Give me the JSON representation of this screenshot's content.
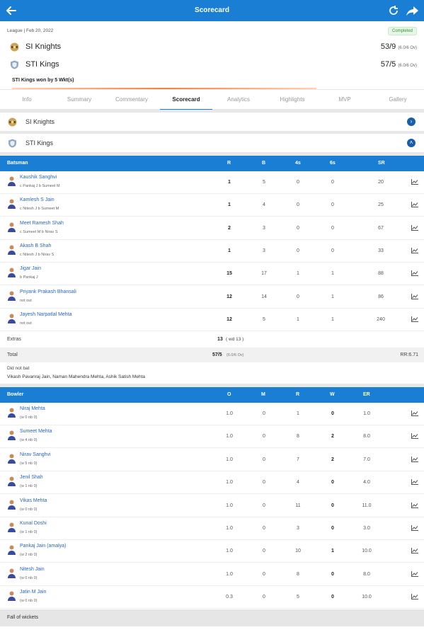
{
  "header": {
    "title": "Scorecard",
    "back_icon": "back-arrow-icon",
    "refresh_icon": "refresh-icon",
    "share_icon": "share-icon",
    "bg_color": "#1a7fd4"
  },
  "match": {
    "meta": "League | Feb 20, 2022",
    "status": "Completed",
    "team1": {
      "name": "SI Knights",
      "score": "53/9",
      "overs": "(6.0/6 Ov)"
    },
    "team2": {
      "name": "STI Kings",
      "score": "57/5",
      "overs": "(6.0/6 Ov)"
    },
    "result": "STI Kings won by 5 Wkt(s)"
  },
  "tabs": [
    "Info",
    "Summary",
    "Commentary",
    "Scorecard",
    "Analytics",
    "Highlights",
    "MVP",
    "Gallery"
  ],
  "active_tab": "Scorecard",
  "innings": [
    {
      "name": "SI Knights",
      "state": "collapsed"
    },
    {
      "name": "STI Kings",
      "state": "expanded"
    }
  ],
  "batting": {
    "headers": {
      "batsman": "Batsman",
      "r": "R",
      "b": "B",
      "fours": "4s",
      "sixes": "6s",
      "sr": "SR"
    },
    "rows": [
      {
        "name": "Kaushik Sanghvi",
        "desc": "c Pankaj J b Sumeet M",
        "r": "1",
        "b": "5",
        "fours": "0",
        "sixes": "0",
        "sr": "20"
      },
      {
        "name": "Kamlesh S Jain",
        "desc": "c Nitesh J b Sumeet M",
        "r": "1",
        "b": "4",
        "fours": "0",
        "sixes": "0",
        "sr": "25"
      },
      {
        "name": "Meet Ramesh Shah",
        "desc": "c Sumeet M b Nirav S",
        "r": "2",
        "b": "3",
        "fours": "0",
        "sixes": "0",
        "sr": "67"
      },
      {
        "name": "Akash B Shah",
        "desc": "c Nitesh J b Nirav S",
        "r": "1",
        "b": "3",
        "fours": "0",
        "sixes": "0",
        "sr": "33"
      },
      {
        "name": "Jigar Jain",
        "desc": "b Pankaj J",
        "r": "15",
        "b": "17",
        "fours": "1",
        "sixes": "1",
        "sr": "88"
      },
      {
        "name": "Priyank Prakash Bhansali",
        "desc": "not out",
        "r": "12",
        "b": "14",
        "fours": "0",
        "sixes": "1",
        "sr": "86"
      },
      {
        "name": "Jayesh Narpatlal Mehta",
        "desc": "not out",
        "r": "12",
        "b": "5",
        "fours": "1",
        "sixes": "1",
        "sr": "240"
      }
    ],
    "extras_label": "Extras",
    "extras_value": "13",
    "extras_detail": "( wd 13 )",
    "total_label": "Total",
    "total_value": "57/5",
    "total_overs": "(6.0/6 Ov)",
    "run_rate": "RR:6.71",
    "dnb_label": "Did not bat",
    "dnb_players": "Vikash Pavanraj Jain, Naman Mahendra Mehta, Ashik Satish Mehta"
  },
  "bowling": {
    "headers": {
      "bowler": "Bowler",
      "o": "O",
      "m": "M",
      "r": "R",
      "w": "W",
      "er": "ER"
    },
    "rows": [
      {
        "name": "Niraj Mehta",
        "desc": "(w 0 nb 0)",
        "o": "1.0",
        "m": "0",
        "r": "1",
        "w": "0",
        "er": "1.0"
      },
      {
        "name": "Sumeet Mehta",
        "desc": "(w 4 nb 0)",
        "o": "1.0",
        "m": "0",
        "r": "8",
        "w": "2",
        "er": "8.0"
      },
      {
        "name": "Nirav Sanghvi",
        "desc": "(w 5 nb 0)",
        "o": "1.0",
        "m": "0",
        "r": "7",
        "w": "2",
        "er": "7.0"
      },
      {
        "name": "Jenil Shah",
        "desc": "(w 1 nb 0)",
        "o": "1.0",
        "m": "0",
        "r": "4",
        "w": "0",
        "er": "4.0"
      },
      {
        "name": "Vikas Mehta",
        "desc": "(w 0 nb 0)",
        "o": "1.0",
        "m": "0",
        "r": "11",
        "w": "0",
        "er": "11.0"
      },
      {
        "name": "Kunal Doshi",
        "desc": "(w 1 nb 0)",
        "o": "1.0",
        "m": "0",
        "r": "3",
        "w": "0",
        "er": "3.0"
      },
      {
        "name": "Pankaj Jain (amalya)",
        "desc": "(w 2 nb 0)",
        "o": "1.0",
        "m": "0",
        "r": "10",
        "w": "1",
        "er": "10.0"
      },
      {
        "name": "Nitesh Jain",
        "desc": "(w 0 nb 0)",
        "o": "1.0",
        "m": "0",
        "r": "8",
        "w": "0",
        "er": "8.0"
      },
      {
        "name": "Jatin M Jain",
        "desc": "(w 0 nb 0)",
        "o": "0.3",
        "m": "0",
        "r": "5",
        "w": "0",
        "er": "10.0"
      }
    ]
  },
  "fall_of_wickets_label": "Fall of wickets",
  "icons": {
    "graph": "chart-icon",
    "team_logo": "shield-logo-icon",
    "player": "player-avatar-icon"
  }
}
